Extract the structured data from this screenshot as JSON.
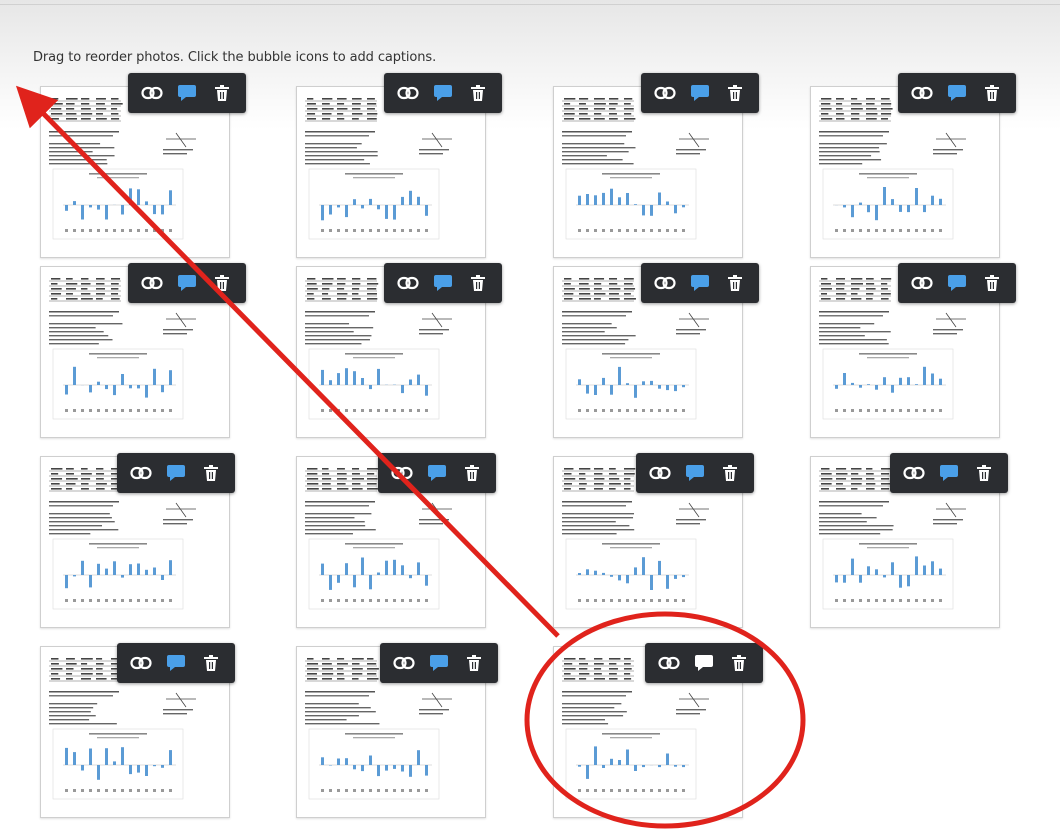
{
  "instructions": "Drag to reorder photos. Click the bubble icons to add captions.",
  "photo_count": 15,
  "active_caption_photo": 15,
  "colors": {
    "toolbar_bg": "#2b2d31",
    "caption_icon_default": "#4a9fe8",
    "caption_icon_active": "#ffffff",
    "annotation": "#e0231c"
  },
  "toolbar_icons": [
    "link-icon",
    "caption-bubble-icon",
    "delete-icon"
  ]
}
